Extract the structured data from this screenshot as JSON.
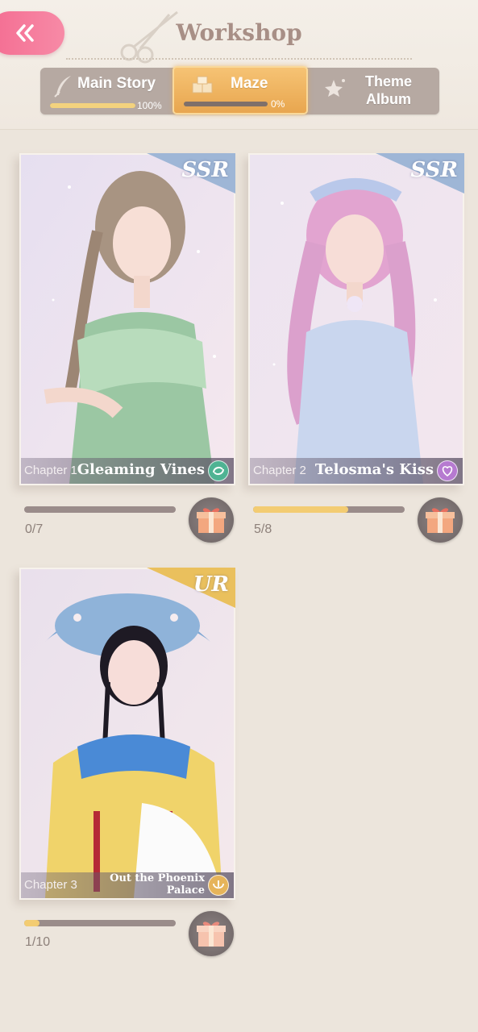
{
  "header": {
    "title": "Workshop"
  },
  "tabs": [
    {
      "label": "Main Story",
      "progress": 100,
      "progress_text": "100%",
      "icon": "quill-icon"
    },
    {
      "label": "Maze",
      "progress": 0,
      "progress_text": "0%",
      "icon": "cubes-icon",
      "active": true
    },
    {
      "label": "Theme Album",
      "icon": "sparkle-star-icon"
    }
  ],
  "chapters": [
    {
      "chapter": "Chapter 1",
      "name": "Gleaming Vines",
      "rarity": "SSR",
      "progress": 0,
      "total": 7,
      "count": "0/7",
      "badge_color": "#4fb393"
    },
    {
      "chapter": "Chapter 2",
      "name": "Telosma's Kiss",
      "rarity": "SSR",
      "progress": 5,
      "total": 8,
      "count": "5/8",
      "badge_color": "#b67ad0"
    },
    {
      "chapter": "Chapter 3",
      "name": "Out the Phoenix Palace",
      "rarity": "UR",
      "progress": 1,
      "total": 10,
      "count": "1/10",
      "badge_color": "#e6b45a"
    }
  ],
  "colors": {
    "accent": "#f7b860",
    "back_button": "#f46d92",
    "progress_fill": "#f3cc72"
  }
}
